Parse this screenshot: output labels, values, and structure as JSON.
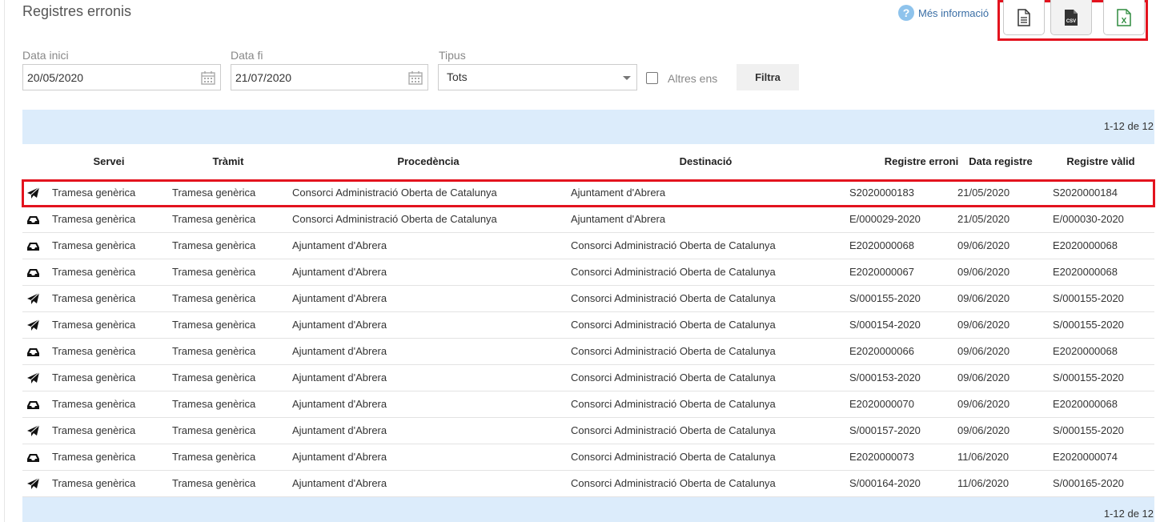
{
  "page": {
    "title": "Registres erronis",
    "info_label": "Més informació",
    "info_icon": "help-circle-icon"
  },
  "exports": [
    {
      "name": "pdf-export",
      "icon": "document-icon"
    },
    {
      "name": "csv-export",
      "icon": "csv-icon",
      "label": "CSV"
    },
    {
      "name": "excel-export",
      "icon": "excel-icon",
      "label": "X"
    }
  ],
  "filters": {
    "start_label": "Data inici",
    "start_value": "20/05/2020",
    "end_label": "Data fi",
    "end_value": "21/07/2020",
    "type_label": "Tipus",
    "type_value": "Tots",
    "other_label": "Altres ens",
    "filter_button": "Filtra"
  },
  "pagination": {
    "label": "1-12 de 12"
  },
  "table": {
    "headers": {
      "servei": "Servei",
      "tramit": "Tràmit",
      "procedencia": "Procedència",
      "destinacio": "Destinació",
      "registre_erroni": "Registre erroni",
      "data_registre": "Data registre",
      "registre_valid": "Registre vàlid"
    },
    "rows": [
      {
        "icon": "send",
        "servei": "Tramesa genèrica",
        "tramit": "Tramesa genèrica",
        "procedencia": "Consorci Administració Oberta de Catalunya",
        "destinacio": "Ajuntament d'Abrera",
        "registre_erroni": "S2020000183",
        "data_registre": "21/05/2020",
        "registre_valid": "S2020000184"
      },
      {
        "icon": "inbox",
        "servei": "Tramesa genèrica",
        "tramit": "Tramesa genèrica",
        "procedencia": "Consorci Administració Oberta de Catalunya",
        "destinacio": "Ajuntament d'Abrera",
        "registre_erroni": "E/000029-2020",
        "data_registre": "21/05/2020",
        "registre_valid": "E/000030-2020"
      },
      {
        "icon": "inbox",
        "servei": "Tramesa genèrica",
        "tramit": "Tramesa genèrica",
        "procedencia": "Ajuntament d'Abrera",
        "destinacio": "Consorci Administració Oberta de Catalunya",
        "registre_erroni": "E2020000068",
        "data_registre": "09/06/2020",
        "registre_valid": "E2020000068"
      },
      {
        "icon": "inbox",
        "servei": "Tramesa genèrica",
        "tramit": "Tramesa genèrica",
        "procedencia": "Ajuntament d'Abrera",
        "destinacio": "Consorci Administració Oberta de Catalunya",
        "registre_erroni": "E2020000067",
        "data_registre": "09/06/2020",
        "registre_valid": "E2020000068"
      },
      {
        "icon": "send",
        "servei": "Tramesa genèrica",
        "tramit": "Tramesa genèrica",
        "procedencia": "Ajuntament d'Abrera",
        "destinacio": "Consorci Administració Oberta de Catalunya",
        "registre_erroni": "S/000155-2020",
        "data_registre": "09/06/2020",
        "registre_valid": "S/000155-2020"
      },
      {
        "icon": "send",
        "servei": "Tramesa genèrica",
        "tramit": "Tramesa genèrica",
        "procedencia": "Ajuntament d'Abrera",
        "destinacio": "Consorci Administració Oberta de Catalunya",
        "registre_erroni": "S/000154-2020",
        "data_registre": "09/06/2020",
        "registre_valid": "S/000155-2020"
      },
      {
        "icon": "inbox",
        "servei": "Tramesa genèrica",
        "tramit": "Tramesa genèrica",
        "procedencia": "Ajuntament d'Abrera",
        "destinacio": "Consorci Administració Oberta de Catalunya",
        "registre_erroni": "E2020000066",
        "data_registre": "09/06/2020",
        "registre_valid": "E2020000068"
      },
      {
        "icon": "send",
        "servei": "Tramesa genèrica",
        "tramit": "Tramesa genèrica",
        "procedencia": "Ajuntament d'Abrera",
        "destinacio": "Consorci Administració Oberta de Catalunya",
        "registre_erroni": "S/000153-2020",
        "data_registre": "09/06/2020",
        "registre_valid": "S/000155-2020"
      },
      {
        "icon": "inbox",
        "servei": "Tramesa genèrica",
        "tramit": "Tramesa genèrica",
        "procedencia": "Ajuntament d'Abrera",
        "destinacio": "Consorci Administració Oberta de Catalunya",
        "registre_erroni": "E2020000070",
        "data_registre": "09/06/2020",
        "registre_valid": "E2020000068"
      },
      {
        "icon": "send",
        "servei": "Tramesa genèrica",
        "tramit": "Tramesa genèrica",
        "procedencia": "Ajuntament d'Abrera",
        "destinacio": "Consorci Administració Oberta de Catalunya",
        "registre_erroni": "S/000157-2020",
        "data_registre": "09/06/2020",
        "registre_valid": "S/000155-2020"
      },
      {
        "icon": "inbox",
        "servei": "Tramesa genèrica",
        "tramit": "Tramesa genèrica",
        "procedencia": "Ajuntament d'Abrera",
        "destinacio": "Consorci Administració Oberta de Catalunya",
        "registre_erroni": "E2020000073",
        "data_registre": "11/06/2020",
        "registre_valid": "E2020000074"
      },
      {
        "icon": "send",
        "servei": "Tramesa genèrica",
        "tramit": "Tramesa genèrica",
        "procedencia": "Ajuntament d'Abrera",
        "destinacio": "Consorci Administració Oberta de Catalunya",
        "registre_erroni": "S/000164-2020",
        "data_registre": "11/06/2020",
        "registre_valid": "S/000165-2020"
      }
    ]
  },
  "colors": {
    "highlight": "#e3131e",
    "pager_bg": "#dcecfb",
    "link": "#3a6ea5",
    "excel_green": "#2e8b3e"
  }
}
